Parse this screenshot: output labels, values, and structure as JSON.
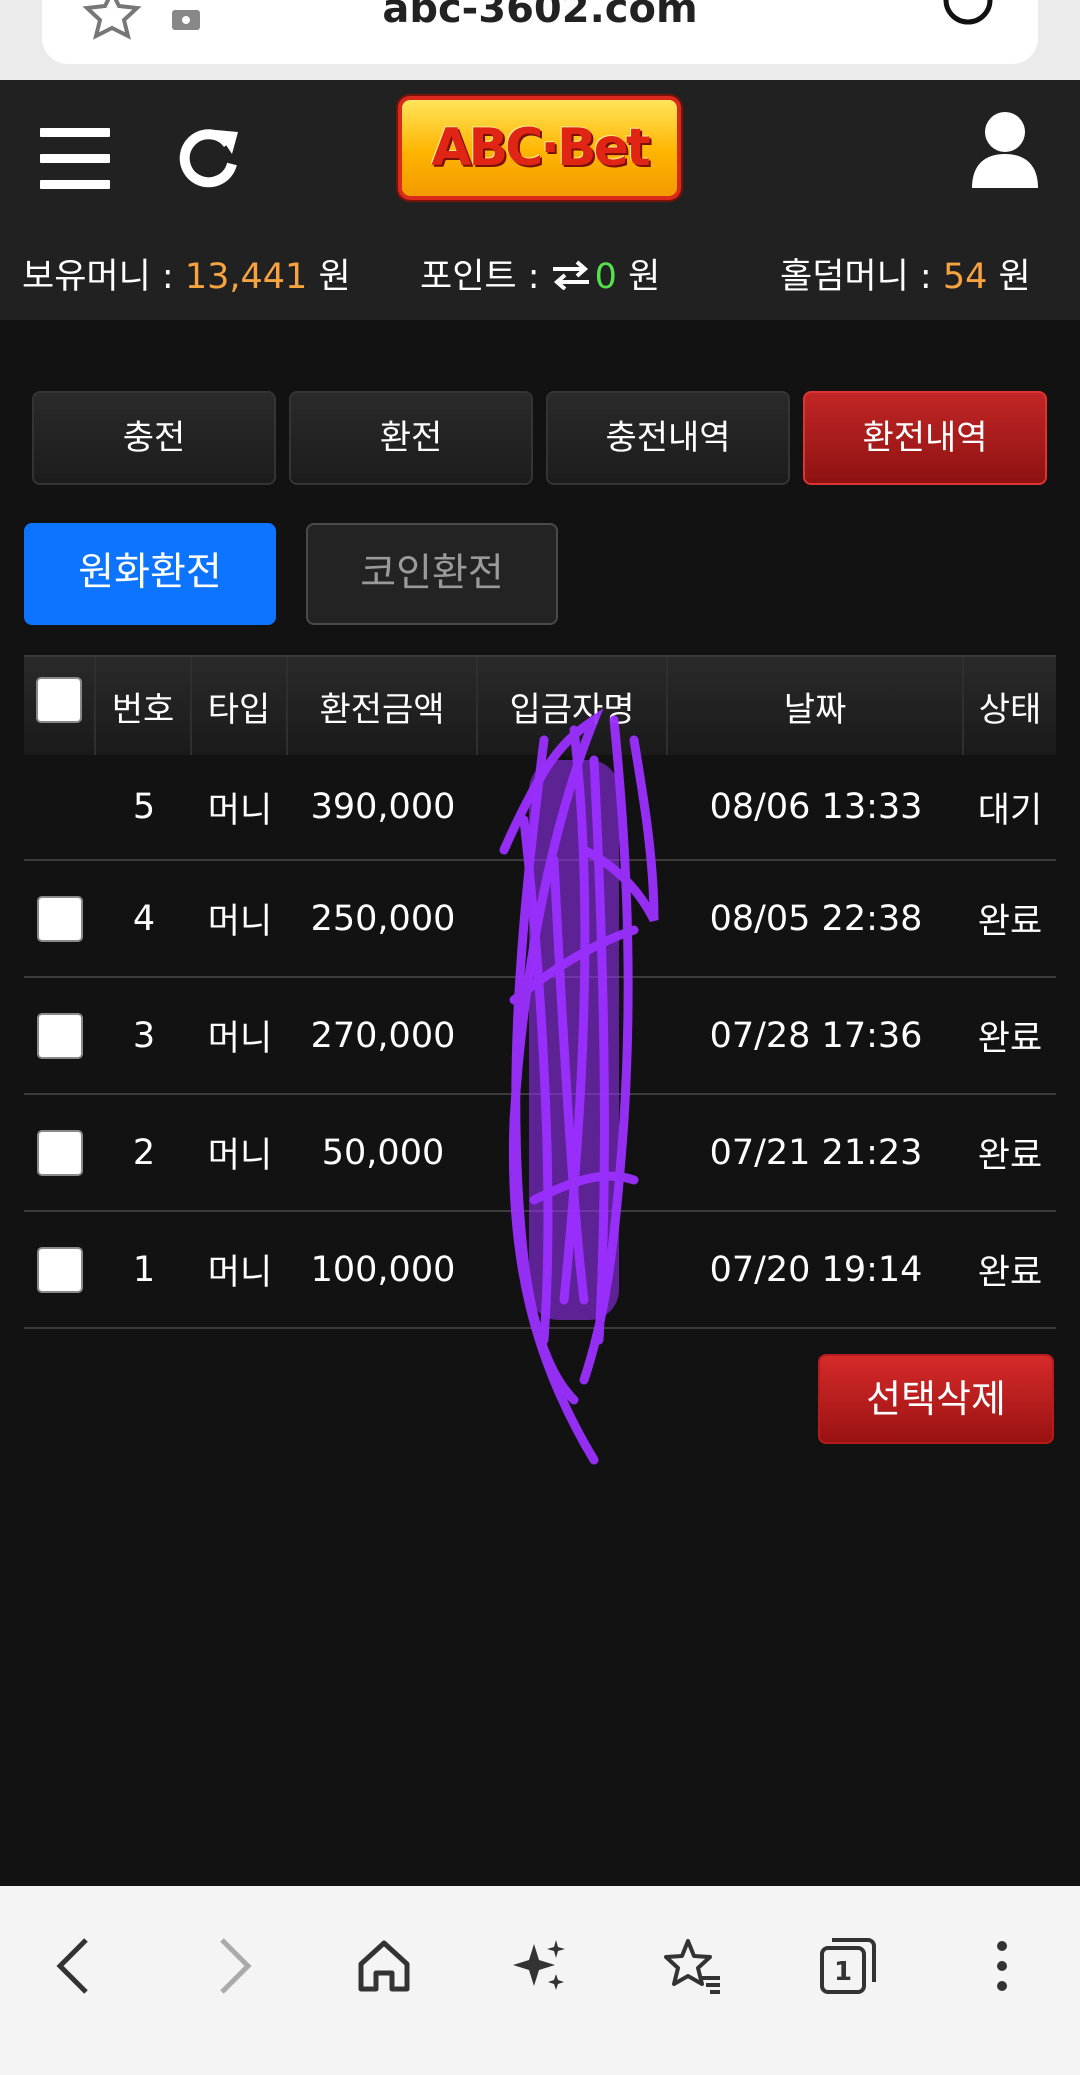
{
  "browser": {
    "url": "abc-3602.com",
    "tabs_count": "1"
  },
  "header": {
    "logo_text": "ABC·Bet",
    "balance_label": "보유머니 : ",
    "balance_value": "13,441",
    "balance_unit": " 원",
    "point_label": "포인트 : ",
    "point_value": "0",
    "point_unit": " 원",
    "holdem_label": "홀덤머니 : ",
    "holdem_value": "54",
    "holdem_unit": " 원"
  },
  "tabs": [
    {
      "label": "충전"
    },
    {
      "label": "환전"
    },
    {
      "label": "충전내역"
    },
    {
      "label": "환전내역"
    }
  ],
  "subtabs": [
    {
      "label": "원화환전"
    },
    {
      "label": "코인환전"
    }
  ],
  "table": {
    "headers": [
      "번호",
      "타입",
      "환전금액",
      "입금자명",
      "날짜",
      "상태"
    ],
    "rows": [
      {
        "no": "5",
        "type": "머니",
        "amount": "390,000",
        "date": "08/06 13:33",
        "status": "대기"
      },
      {
        "no": "4",
        "type": "머니",
        "amount": "250,000",
        "date": "08/05 22:38",
        "status": "완료"
      },
      {
        "no": "3",
        "type": "머니",
        "amount": "270,000",
        "date": "07/28 17:36",
        "status": "완료"
      },
      {
        "no": "2",
        "type": "머니",
        "amount": "50,000",
        "date": "07/21 21:23",
        "status": "완료"
      },
      {
        "no": "1",
        "type": "머니",
        "amount": "100,000",
        "date": "07/20 19:14",
        "status": "완료"
      }
    ]
  },
  "actions": {
    "delete_label": "선택삭제"
  },
  "colors": {
    "accent_red": "#c22626",
    "accent_blue": "#0d74ff",
    "orange_value": "#f6a340",
    "green_value": "#57e04d",
    "redaction": "#9b30ff"
  }
}
